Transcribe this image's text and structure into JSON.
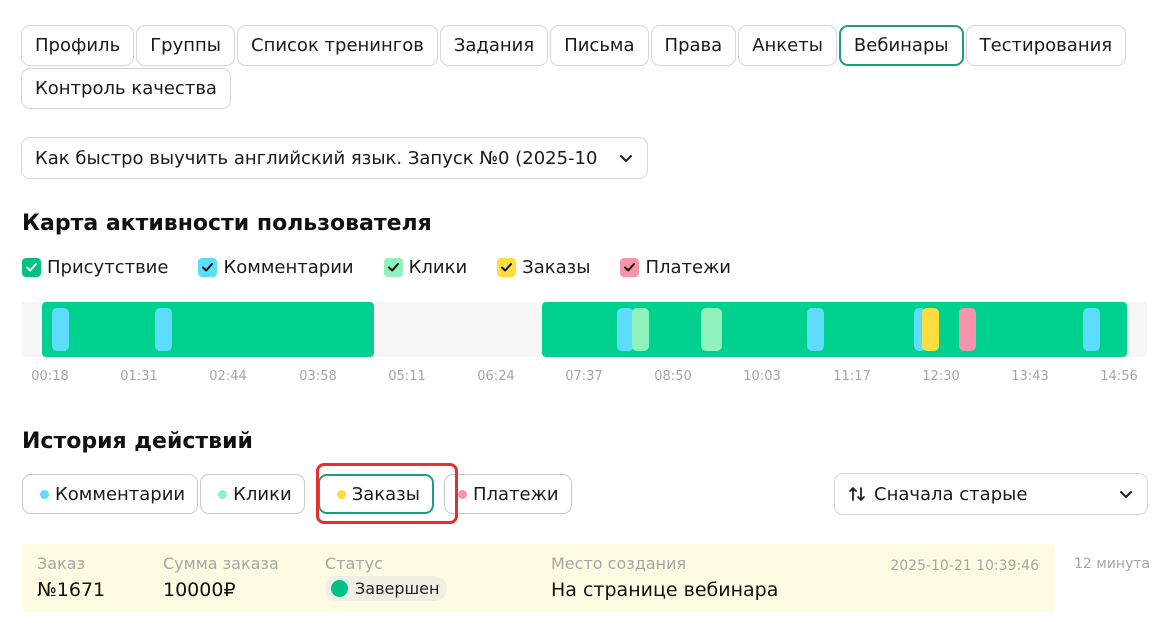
{
  "tabs": [
    {
      "label": "Профиль",
      "active": false
    },
    {
      "label": "Группы",
      "active": false
    },
    {
      "label": "Список тренингов",
      "active": false
    },
    {
      "label": "Задания",
      "active": false
    },
    {
      "label": "Письма",
      "active": false
    },
    {
      "label": "Права",
      "active": false
    },
    {
      "label": "Анкеты",
      "active": false
    },
    {
      "label": "Вебинары",
      "active": true
    },
    {
      "label": "Тестирования",
      "active": false
    },
    {
      "label": "Контроль качества",
      "active": false
    }
  ],
  "webinar_select": {
    "value": "Как быстро выучить английский язык. Запуск №0 (2025-10"
  },
  "activity_map": {
    "title": "Карта активности пользователя",
    "legend": [
      {
        "label": "Присутствие",
        "color": "#00c181",
        "checked": true
      },
      {
        "label": "Комментарии",
        "color": "#5ddcfb",
        "checked": true
      },
      {
        "label": "Клики",
        "color": "#8ff2bd",
        "checked": true
      },
      {
        "label": "Заказы",
        "color": "#ffdd3c",
        "checked": true
      },
      {
        "label": "Платежи",
        "color": "#f794a9",
        "checked": true
      }
    ],
    "time_axis": [
      "00:18",
      "01:31",
      "02:44",
      "03:58",
      "05:11",
      "06:24",
      "07:37",
      "08:50",
      "10:03",
      "11:17",
      "12:30",
      "13:43",
      "14:56"
    ],
    "presence_color": "#00d18f"
  },
  "history": {
    "title": "История действий",
    "filters": [
      {
        "label": "Комментарии",
        "color": "#5ddcfb",
        "active": false
      },
      {
        "label": "Клики",
        "color": "#8ff2bd",
        "active": false
      },
      {
        "label": "Заказы",
        "color": "#ffdd3c",
        "active": true
      },
      {
        "label": "Платежи",
        "color": "#f794a9",
        "active": false
      }
    ],
    "sort": {
      "value": "Сначала старые"
    },
    "rows": [
      {
        "order_label": "Заказ",
        "order_value": "№1671",
        "sum_label": "Сумма заказа",
        "sum_value": "10000₽",
        "status_label": "Статус",
        "status_value": "Завершен",
        "place_label": "Место создания",
        "place_value": "На странице вебинара",
        "timestamp": "2025-10-21 10:39:46",
        "duration": "12 минута"
      }
    ]
  },
  "colors": {
    "accent": "#1a9e80",
    "highlight": "#e03131",
    "row_bg": "#fffbe3"
  }
}
